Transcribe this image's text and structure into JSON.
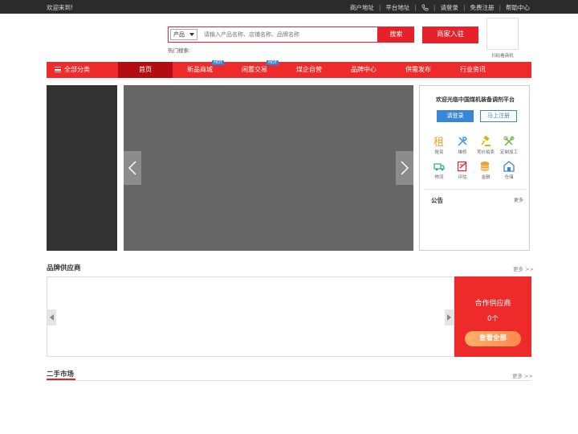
{
  "topbar": {
    "welcome": "欢迎来到!",
    "links": [
      "商户地址",
      "平台地址",
      "请登录",
      "免费注册",
      "帮助中心"
    ]
  },
  "search": {
    "category": "产品",
    "placeholder": "请输入产品名称、店铺名称、品牌名称",
    "button": "搜索",
    "hot_label": "热门搜索:"
  },
  "header": {
    "merchant_button": "商家入驻",
    "qr_caption": "扫码看商机"
  },
  "nav": {
    "category_label": "全部分类",
    "items": [
      {
        "label": "首页",
        "badge": ""
      },
      {
        "label": "新品商城",
        "badge": "HOT"
      },
      {
        "label": "闲置交易",
        "badge": "HOT"
      },
      {
        "label": "煤企自营",
        "badge": ""
      },
      {
        "label": "品牌中心",
        "badge": ""
      },
      {
        "label": "供需发布",
        "badge": ""
      },
      {
        "label": "行业资讯",
        "badge": ""
      }
    ]
  },
  "login_panel": {
    "welcome": "欢迎光临中国煤机装备调剂平台",
    "login": "请登录",
    "register": "马上注册",
    "services": [
      {
        "label": "租赁",
        "icon": "rent-icon",
        "color": "#f0a030"
      },
      {
        "label": "维修",
        "icon": "repair-icon",
        "color": "#3a86d6"
      },
      {
        "label": "竞价拍卖",
        "icon": "auction-icon",
        "color": "#e0b000"
      },
      {
        "label": "定制加工",
        "icon": "custom-process-icon",
        "color": "#6cb33f"
      },
      {
        "label": "物流",
        "icon": "logistics-icon",
        "color": "#2aa88a"
      },
      {
        "label": "评估",
        "icon": "evaluation-icon",
        "color": "#e62129"
      },
      {
        "label": "金融",
        "icon": "finance-icon",
        "color": "#f0a030"
      },
      {
        "label": "仓储",
        "icon": "warehouse-icon",
        "color": "#3a86d6"
      }
    ],
    "notice_title": "公告",
    "notice_more": "更多"
  },
  "brand_section": {
    "title": "品牌供应商",
    "more": "更多 >>",
    "partner_title": "合作供应商",
    "partner_count": "0个",
    "view_all": "查看全部"
  },
  "used_section": {
    "title": "二手市场",
    "more": "更多 >>"
  },
  "colors": {
    "accent": "#e62129",
    "nav_bg": "#ee2a2a",
    "nav_active": "#b30d12",
    "blue": "#3a86d6",
    "topbar": "#2b2b2b"
  }
}
